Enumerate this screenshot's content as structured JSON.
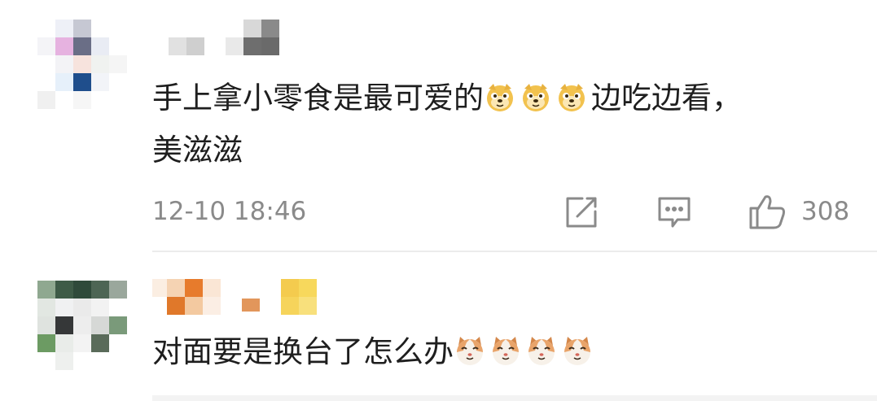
{
  "comments": [
    {
      "text_before": "手上拿小零食是最可爱的",
      "emojis_1": [
        "doge-emoji",
        "doge-emoji",
        "doge-emoji"
      ],
      "text_after_line1": "边吃边看，",
      "line2": "美滋滋",
      "timestamp": "12-10 18:46",
      "like_count": "308",
      "icons": [
        "repost-icon",
        "comment-icon",
        "like-icon"
      ]
    },
    {
      "text_before": "对面要是换台了怎么办",
      "emojis_1": [
        "cat-emoji",
        "cat-emoji",
        "cat-emoji",
        "cat-emoji"
      ]
    }
  ],
  "colors": {
    "text": "#1e1e1e",
    "meta": "#8a8a8a",
    "divider": "#ececec",
    "doge": "#f2c24e",
    "cat": "#e9a46a"
  }
}
